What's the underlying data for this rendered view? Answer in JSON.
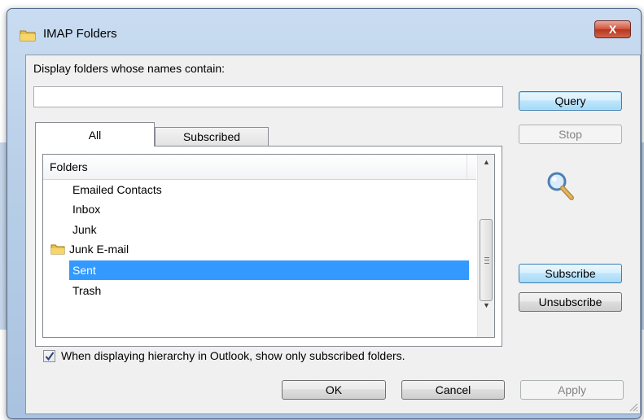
{
  "window": {
    "title": "IMAP Folders",
    "close_symbol": "X"
  },
  "filter": {
    "label": "Display folders whose names contain:",
    "value": "",
    "placeholder": ""
  },
  "buttons": {
    "query": "Query",
    "stop": "Stop",
    "subscribe": "Subscribe",
    "unsubscribe": "Unsubscribe",
    "ok": "OK",
    "cancel": "Cancel",
    "apply": "Apply"
  },
  "tabs": [
    {
      "label": "All",
      "active": true
    },
    {
      "label": "Subscribed",
      "active": false
    }
  ],
  "list": {
    "header": "Folders",
    "items": [
      {
        "label": "Emailed Contacts",
        "icon": "none",
        "selected": false
      },
      {
        "label": "Inbox",
        "icon": "none",
        "selected": false
      },
      {
        "label": "Junk",
        "icon": "none",
        "selected": false
      },
      {
        "label": "Junk E-mail",
        "icon": "folder-icon",
        "selected": false
      },
      {
        "label": "Sent",
        "icon": "none",
        "selected": true
      },
      {
        "label": "Trash",
        "icon": "none",
        "selected": false
      }
    ]
  },
  "option": {
    "checked": true,
    "label": "When displaying hierarchy in Outlook, show only subscribed folders."
  },
  "colors": {
    "selection": "#3399ff",
    "default_button_border": "#3c7fb1"
  }
}
